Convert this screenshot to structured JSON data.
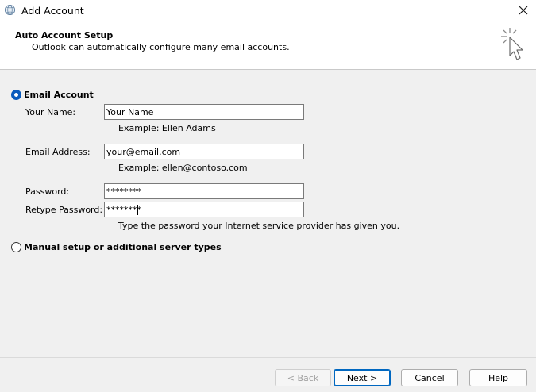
{
  "window": {
    "title": "Add Account"
  },
  "header": {
    "title": "Auto Account Setup",
    "subtitle": "Outlook can automatically configure many email accounts."
  },
  "options": {
    "email_account": {
      "label": "Email Account",
      "selected": true
    },
    "manual_setup": {
      "label": "Manual setup or additional server types",
      "selected": false
    }
  },
  "form": {
    "name": {
      "label": "Your Name:",
      "value": "Your Name",
      "hint": "Example: Ellen Adams"
    },
    "email": {
      "label": "Email Address:",
      "value": "your@email.com",
      "hint": "Example: ellen@contoso.com"
    },
    "password": {
      "label": "Password:",
      "value": "********"
    },
    "retype": {
      "label": "Retype Password:",
      "value": "********",
      "hint": "Type the password your Internet service provider has given you."
    }
  },
  "buttons": {
    "back": "< Back",
    "next": "Next >",
    "cancel": "Cancel",
    "help": "Help"
  },
  "colors": {
    "accent": "#0a5bbd",
    "button_focus": "#0067c0"
  },
  "icons": {
    "app": "globe-icon",
    "close": "close-icon",
    "wizard": "click-sparkle-cursor-icon"
  }
}
